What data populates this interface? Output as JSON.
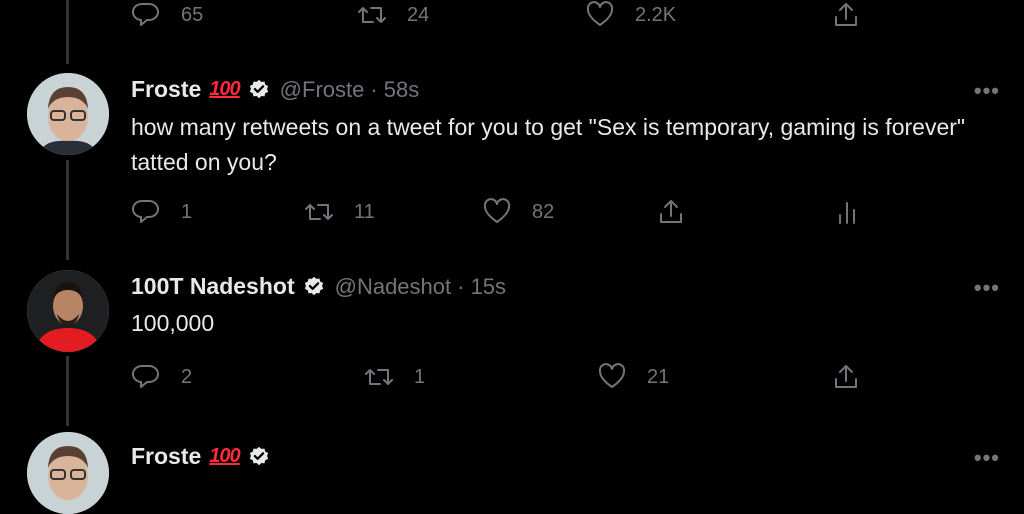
{
  "top_tweet": {
    "reply_count": "65",
    "retweet_count": "24",
    "like_count": "2.2K"
  },
  "tweets": [
    {
      "name": "Froste",
      "emoji": "100",
      "handle": "@Froste",
      "time": "· 58s",
      "text": "how many retweets on a tweet for you to get \"Sex is temporary, gaming is forever\" tatted on you?",
      "reply_count": "1",
      "retweet_count": "11",
      "like_count": "82"
    },
    {
      "name": "100T Nadeshot",
      "handle": "@Nadeshot",
      "time": "· 15s",
      "text": "100,000",
      "reply_count": "2",
      "retweet_count": "1",
      "like_count": "21"
    },
    {
      "name": "Froste",
      "emoji": "100"
    }
  ],
  "more_label": "•••",
  "colors": {
    "background": "#000000",
    "text": "#e7e9ea",
    "secondary": "#71767b",
    "emoji_red": "#ff2a3a"
  },
  "icons": [
    "reply-icon",
    "retweet-icon",
    "like-icon",
    "share-icon",
    "analytics-icon",
    "verified-badge-icon"
  ]
}
